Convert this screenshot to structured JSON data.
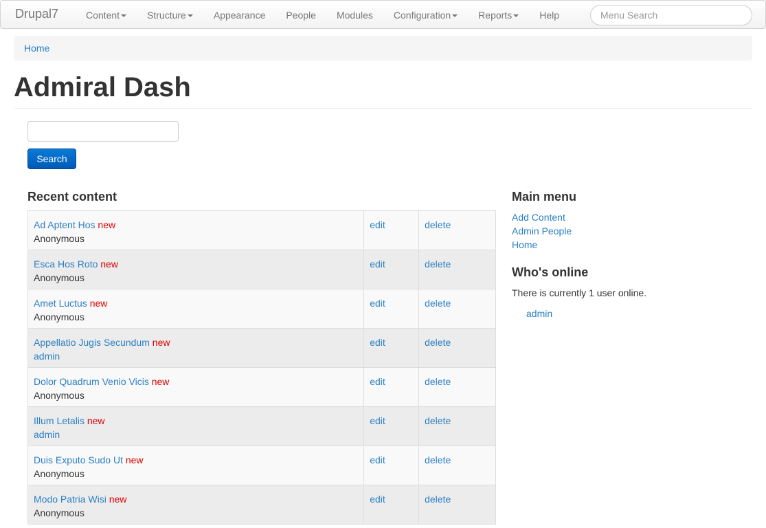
{
  "navbar": {
    "brand": "Drupal7",
    "items": [
      {
        "label": "Content",
        "dropdown": true
      },
      {
        "label": "Structure",
        "dropdown": true
      },
      {
        "label": "Appearance",
        "dropdown": false
      },
      {
        "label": "People",
        "dropdown": false
      },
      {
        "label": "Modules",
        "dropdown": false
      },
      {
        "label": "Configuration",
        "dropdown": true
      },
      {
        "label": "Reports",
        "dropdown": true
      },
      {
        "label": "Help",
        "dropdown": false
      }
    ],
    "search_placeholder": "Menu Search"
  },
  "breadcrumb": {
    "home": "Home"
  },
  "page": {
    "title": "Admiral Dash"
  },
  "search": {
    "value": "",
    "button": "Search"
  },
  "recent_content": {
    "title": "Recent content",
    "new_label": "new",
    "edit_label": "edit",
    "delete_label": "delete",
    "rows": [
      {
        "title": "Ad Aptent Hos",
        "author": "Anonymous",
        "author_link": false
      },
      {
        "title": "Esca Hos Roto",
        "author": "Anonymous",
        "author_link": false
      },
      {
        "title": "Amet Luctus",
        "author": "Anonymous",
        "author_link": false
      },
      {
        "title": "Appellatio Jugis Secundum",
        "author": "admin",
        "author_link": true
      },
      {
        "title": "Dolor Quadrum Venio Vicis",
        "author": "Anonymous",
        "author_link": false
      },
      {
        "title": "Illum Letalis",
        "author": "admin",
        "author_link": true
      },
      {
        "title": "Duis Exputo Sudo Ut",
        "author": "Anonymous",
        "author_link": false
      },
      {
        "title": "Modo Patria Wisi",
        "author": "Anonymous",
        "author_link": false
      }
    ]
  },
  "main_menu": {
    "title": "Main menu",
    "items": [
      "Add Content",
      "Admin People",
      "Home"
    ]
  },
  "whos_online": {
    "title": "Who's online",
    "text": "There is currently 1 user online.",
    "users": [
      "admin"
    ]
  },
  "colors": {
    "link": "#2a7fc4",
    "new_marker": "#e00000",
    "primary_button": "#0a6fd0"
  }
}
